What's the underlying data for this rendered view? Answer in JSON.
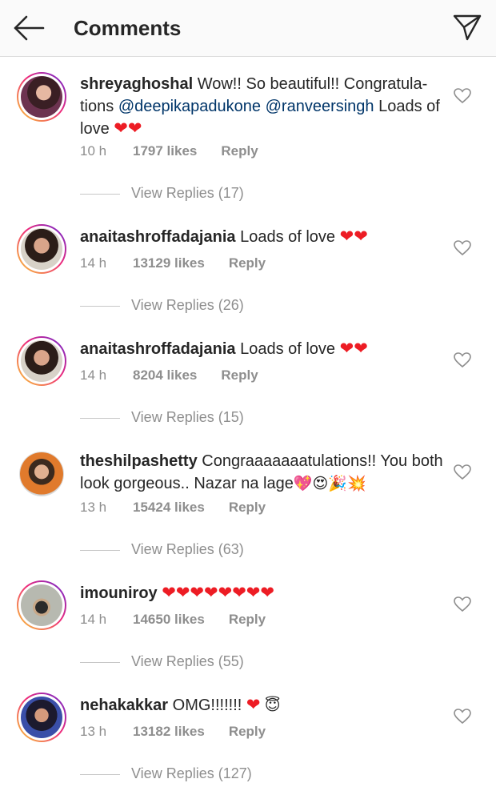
{
  "header": {
    "title": "Comments",
    "back_icon": "arrow-left-icon",
    "send_icon": "paper-plane-icon"
  },
  "colors": {
    "mention": "#003569",
    "heart": "#ed1c24",
    "muted": "#8e8e8e"
  },
  "comments": [
    {
      "username": "shreyaghoshal",
      "text_before": " Wow!! So beautiful!! Congratula-tions ",
      "mention1": "@deepikapadukone",
      "mention2": "@ranveersingh",
      "text_after": " Loads of love",
      "hearts": "❤❤",
      "time": "10 h",
      "likes": "1797 likes",
      "reply": "Reply",
      "view_replies": "View Replies (17)"
    },
    {
      "username": "anaitashroffadajania",
      "text": " Loads of love",
      "hearts": "❤❤",
      "time": "14 h",
      "likes": "13129 likes",
      "reply": "Reply",
      "view_replies": "View Replies (26)"
    },
    {
      "username": "anaitashroffadajania",
      "text": " Loads of love",
      "hearts": "❤❤",
      "time": "14 h",
      "likes": "8204 likes",
      "reply": "Reply",
      "view_replies": "View Replies (15)"
    },
    {
      "username": "theshilpashetty",
      "text": " Congraaaaaaatulations!! You both look gorgeous.. Nazar na lage",
      "emojis": "💖😍🎉💥",
      "time": "13 h",
      "likes": "15424 likes",
      "reply": "Reply",
      "view_replies": "View Replies (63)"
    },
    {
      "username": "imouniroy",
      "hearts": "❤❤❤❤❤❤❤❤",
      "time": "14 h",
      "likes": "14650 likes",
      "reply": "Reply",
      "view_replies": "View Replies (55)"
    },
    {
      "username": "nehakakkar",
      "text": " OMG!!!!!!! ",
      "hearts": "❤",
      "emojis": " 😇",
      "time": "13 h",
      "likes": "13182 likes",
      "reply": "Reply",
      "view_replies": "View Replies (127)"
    }
  ]
}
